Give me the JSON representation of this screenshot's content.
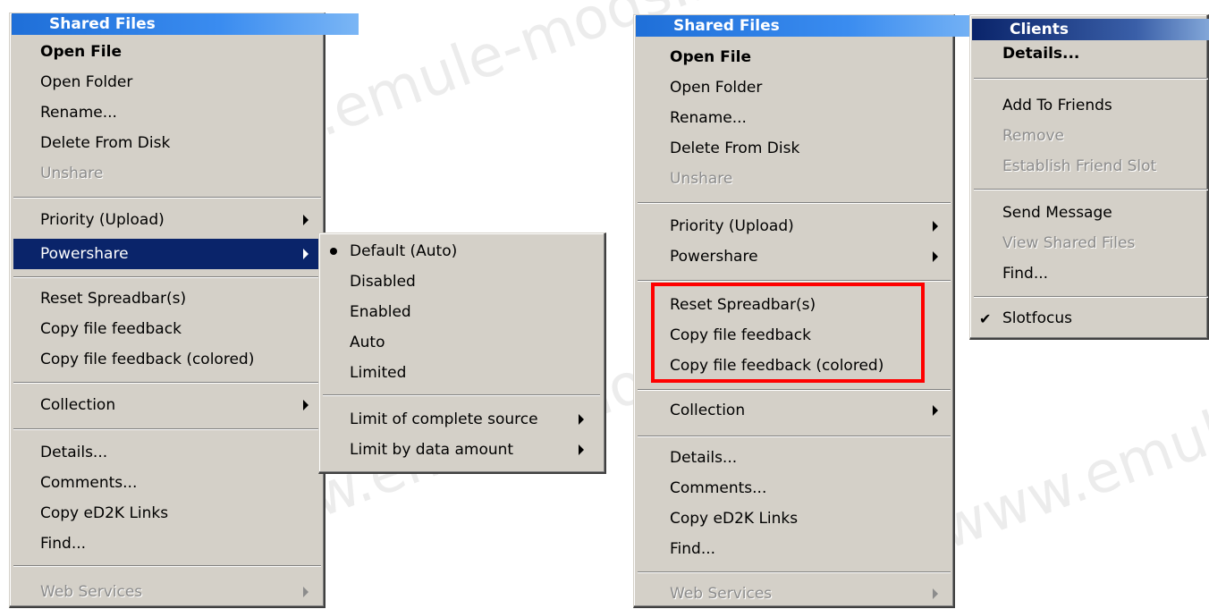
{
  "watermark": "www.emule-mods.it",
  "left_menu": {
    "title": "Shared Files",
    "groups": [
      [
        {
          "label": "Open File",
          "bold": true
        },
        {
          "label": "Open Folder"
        },
        {
          "label": "Rename..."
        },
        {
          "label": "Delete From Disk"
        },
        {
          "label": "Unshare",
          "disabled": true
        }
      ],
      [
        {
          "label": "Priority (Upload)",
          "submenu": true
        },
        {
          "label": "Powershare",
          "submenu": true,
          "highlighted": true
        }
      ],
      [
        {
          "label": "Reset Spreadbar(s)"
        },
        {
          "label": "Copy file feedback"
        },
        {
          "label": "Copy file feedback (colored)"
        }
      ],
      [
        {
          "label": "Collection",
          "submenu": true
        }
      ],
      [
        {
          "label": "Details..."
        },
        {
          "label": "Comments..."
        },
        {
          "label": "Copy eD2K Links"
        },
        {
          "label": "Find..."
        }
      ],
      [
        {
          "label": "Web Services",
          "submenu": true,
          "disabled": true
        }
      ]
    ]
  },
  "powershare_submenu": {
    "items": [
      {
        "label": "Default (Auto)",
        "selected": true
      },
      {
        "label": "Disabled"
      },
      {
        "label": "Enabled"
      },
      {
        "label": "Auto"
      },
      {
        "label": "Limited"
      }
    ],
    "items2": [
      {
        "label": "Limit of complete source",
        "submenu": true
      },
      {
        "label": "Limit by data amount",
        "submenu": true
      }
    ]
  },
  "right_menu": {
    "title": "Shared Files",
    "groups": [
      [
        {
          "label": "Open File",
          "bold": true
        },
        {
          "label": "Open Folder"
        },
        {
          "label": "Rename..."
        },
        {
          "label": "Delete From Disk"
        },
        {
          "label": "Unshare",
          "disabled": true
        }
      ],
      [
        {
          "label": "Priority (Upload)",
          "submenu": true
        },
        {
          "label": "Powershare",
          "submenu": true
        }
      ],
      [
        {
          "label": "Reset Spreadbar(s)"
        },
        {
          "label": "Copy file feedback"
        },
        {
          "label": "Copy file feedback (colored)"
        }
      ],
      [
        {
          "label": "Collection",
          "submenu": true
        }
      ],
      [
        {
          "label": "Details..."
        },
        {
          "label": "Comments..."
        },
        {
          "label": "Copy eD2K Links"
        },
        {
          "label": "Find..."
        }
      ],
      [
        {
          "label": "Web Services",
          "submenu": true,
          "disabled": true
        }
      ]
    ]
  },
  "clients_menu": {
    "title": "Clients",
    "groups": [
      [
        {
          "label": "Details...",
          "bold": true
        }
      ],
      [
        {
          "label": "Add To Friends"
        },
        {
          "label": "Remove",
          "disabled": true
        },
        {
          "label": "Establish Friend Slot",
          "disabled": true
        }
      ],
      [
        {
          "label": "Send Message"
        },
        {
          "label": "View Shared Files",
          "disabled": true
        },
        {
          "label": "Find..."
        }
      ],
      [
        {
          "label": "Slotfocus",
          "checked": true
        }
      ]
    ]
  }
}
